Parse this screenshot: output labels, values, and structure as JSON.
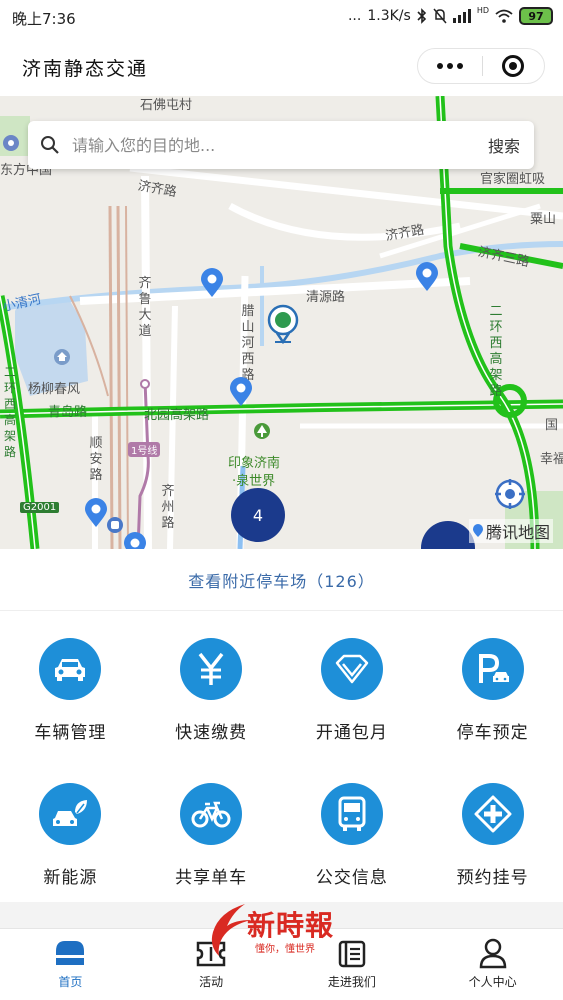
{
  "status_bar": {
    "time": "晚上7:36",
    "dots": "...",
    "speed": "1.3K/s",
    "net": "HD",
    "battery": "97"
  },
  "title_bar": {
    "title": "济南静态交通"
  },
  "map": {
    "search": {
      "placeholder": "请输入您的目的地...",
      "button": "搜索"
    },
    "labels": {
      "shifotun": "石佛屯村",
      "dongfang": "东方中国",
      "jiqi_road_1": "济齐路",
      "jiqi_road_2": "济齐路",
      "guanjia": "官家圈虹吸",
      "suli": "粟山",
      "xiaoqing": "小清河",
      "qingyuan": "清源路",
      "jiqiao_road": "济齐三路",
      "yangliu": "杨柳春风",
      "qingdao": "青岛路",
      "beiyuan": "北园高架路",
      "qilu": "齐鲁大道",
      "lashan": "腊山河西路",
      "shunan": "顺安路",
      "qizhou": "齐州路",
      "yinxiang": "印象济南",
      "quanshijie": "·泉世界",
      "erhuan": "二环西高架路",
      "xinghu": "幸福",
      "guo": "国",
      "line1": "1号线",
      "g2001": "G2001",
      "ring_left": "二环西高架路"
    },
    "cluster_count": "4",
    "brand": "腾讯地图",
    "colors": {
      "road_green": "#22c11a",
      "road_white": "#ffffff",
      "water": "#b7d6f2",
      "pin_blue": "#3b83e6",
      "cluster": "#1b3a8c"
    }
  },
  "nearby": {
    "text": "查看附近停车场（126）"
  },
  "services": [
    {
      "label": "车辆管理",
      "icon": "car-icon"
    },
    {
      "label": "快速缴费",
      "icon": "yen-icon"
    },
    {
      "label": "开通包月",
      "icon": "diamond-icon"
    },
    {
      "label": "停车预定",
      "icon": "parking-icon"
    },
    {
      "label": "新能源",
      "icon": "eco-car-icon"
    },
    {
      "label": "共享单车",
      "icon": "bicycle-icon"
    },
    {
      "label": "公交信息",
      "icon": "bus-icon"
    },
    {
      "label": "预约挂号",
      "icon": "medical-cross-icon"
    }
  ],
  "watermark": {
    "main": "新時報",
    "sub": "懂你，懂世界"
  },
  "tabs": [
    {
      "label": "首页",
      "icon": "home-icon",
      "active": true
    },
    {
      "label": "活动",
      "icon": "ticket-icon",
      "active": false
    },
    {
      "label": "走进我们",
      "icon": "list-icon",
      "active": false
    },
    {
      "label": "个人中心",
      "icon": "person-icon",
      "active": false
    }
  ]
}
